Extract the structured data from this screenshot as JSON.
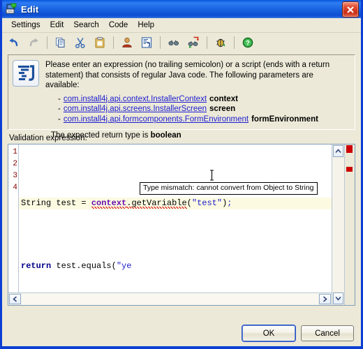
{
  "window": {
    "title": "Edit",
    "title_icon": "script-edit-icon",
    "close_label": "Close"
  },
  "menubar": {
    "items": [
      {
        "label": "Settings",
        "name": "menu-settings"
      },
      {
        "label": "Edit",
        "name": "menu-edit"
      },
      {
        "label": "Search",
        "name": "menu-search"
      },
      {
        "label": "Code",
        "name": "menu-code"
      },
      {
        "label": "Help",
        "name": "menu-help"
      }
    ]
  },
  "toolbar": {
    "buttons": [
      {
        "name": "undo-icon",
        "tip": "Undo"
      },
      {
        "name": "redo-icon",
        "tip": "Redo"
      },
      {
        "name": "copy-icon",
        "tip": "Copy"
      },
      {
        "name": "cut-icon",
        "tip": "Cut"
      },
      {
        "name": "paste-icon",
        "tip": "Paste"
      },
      {
        "name": "user-icon",
        "tip": "Insert user"
      },
      {
        "name": "script-properties-icon",
        "tip": "Script properties"
      },
      {
        "name": "find-icon",
        "tip": "Find"
      },
      {
        "name": "find-next-icon",
        "tip": "Find next"
      },
      {
        "name": "debug-icon",
        "tip": "Debug"
      },
      {
        "name": "help-icon",
        "tip": "Help"
      }
    ]
  },
  "info": {
    "icon": "java-script-icon",
    "intro": "Please enter an expression (no trailing semicolon) or a script (ends with a return statement) that consists of regular Java code. The following parameters are available:",
    "parameters": [
      {
        "type": "com.install4j.api.context.InstallerContext",
        "name": "context"
      },
      {
        "type": "com.install4j.api.screens.InstallerScreen",
        "name": "screen"
      },
      {
        "type": "com.install4j.api.formcomponents.FormEnvironment",
        "name": "formEnvironment"
      }
    ],
    "return_prefix": "The expected return type is ",
    "return_type": "boolean"
  },
  "editor": {
    "label": "Validation expression:",
    "line_numbers": [
      "1",
      "2",
      "3",
      "4"
    ],
    "lines": [
      {
        "number": "1",
        "text": "",
        "highlighted": false
      },
      {
        "number": "2",
        "text": "String test = context.getVariable(\"test\");",
        "highlighted": true
      },
      {
        "number": "3",
        "text": "",
        "highlighted": false
      },
      {
        "number": "4",
        "text": "return test.equals(\"yes\");",
        "highlighted": false
      }
    ],
    "tokens_line2": {
      "pre": "String test = ",
      "error_token": "context",
      "dot": ".",
      "method": "getVariable",
      "open": "(",
      "string": "\"test\"",
      "close": ")",
      "semi": ";"
    },
    "tokens_line4": {
      "keyword": "return",
      "mid": " test.equals(",
      "string": "\"ye"
    },
    "tooltip": "Type mismatch: cannot convert from Object to String",
    "error_markers": 2,
    "colors": {
      "current_line": "#fcfbe2",
      "line_number": "#7f0000",
      "keyword_blue": "#00008b",
      "identifier_purple": "#6a0dad",
      "string_blue": "#1b1bcd",
      "error_squiggle": "#d40000",
      "error_marker": "#cc0000"
    }
  },
  "buttons": {
    "ok": "OK",
    "cancel": "Cancel"
  }
}
